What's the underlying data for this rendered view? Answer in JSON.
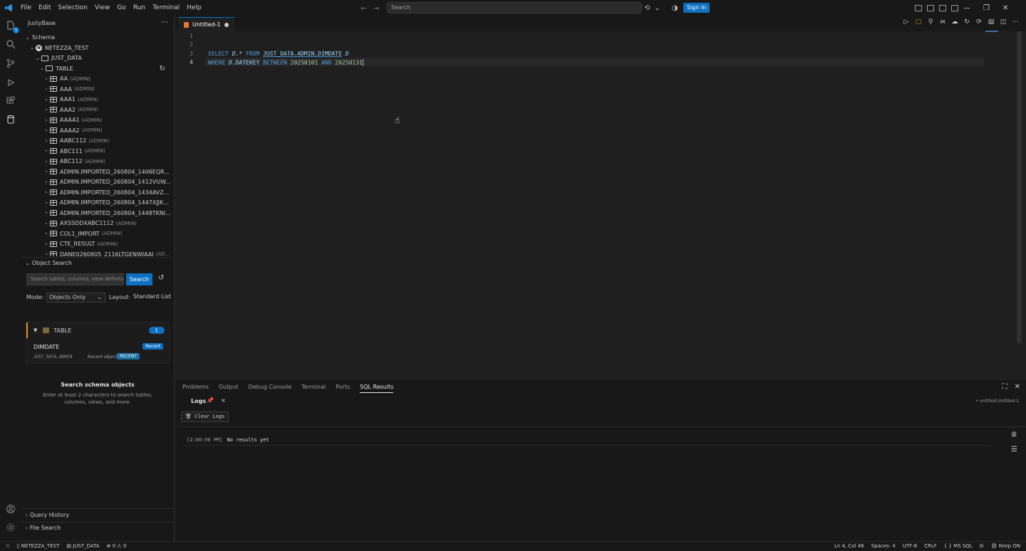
{
  "menu": [
    "File",
    "Edit",
    "Selection",
    "View",
    "Go",
    "Run",
    "Terminal",
    "Help"
  ],
  "command_center": {
    "placeholder": "Search"
  },
  "account": {
    "sign_in": "Sign In"
  },
  "activity": {
    "explorer_badge": "1"
  },
  "sidebar": {
    "title": "JustyBase",
    "schema_section": "Schema",
    "tree": [
      {
        "label": "NETEZZA_TEST",
        "owner": "",
        "kind": "server",
        "depth": 1
      },
      {
        "label": "JUST_DATA",
        "owner": "",
        "kind": "db",
        "depth": 2
      },
      {
        "label": "TABLE",
        "owner": "",
        "kind": "folder",
        "depth": 3
      },
      {
        "label": "AA",
        "owner": "(ADMIN)",
        "kind": "table",
        "depth": 4
      },
      {
        "label": "AAA",
        "owner": "(ADMIN)",
        "kind": "table",
        "depth": 4
      },
      {
        "label": "AAA1",
        "owner": "(ADMIN)",
        "kind": "table",
        "depth": 4
      },
      {
        "label": "AAA2",
        "owner": "(ADMIN)",
        "kind": "table",
        "depth": 4
      },
      {
        "label": "AAAA1",
        "owner": "(ADMIN)",
        "kind": "table",
        "depth": 4
      },
      {
        "label": "AAAA2",
        "owner": "(ADMIN)",
        "kind": "table",
        "depth": 4
      },
      {
        "label": "AABC112",
        "owner": "(ADMIN)",
        "kind": "table",
        "depth": 4
      },
      {
        "label": "ABC111",
        "owner": "(ADMIN)",
        "kind": "table",
        "depth": 4
      },
      {
        "label": "ABC112",
        "owner": "(ADMIN)",
        "kind": "table",
        "depth": 4
      },
      {
        "label": "ADMIN.IMPORTED_260804_1406EQR...",
        "owner": "",
        "kind": "table",
        "depth": 4
      },
      {
        "label": "ADMIN.IMPORTED_260804_1412VUW...",
        "owner": "",
        "kind": "table",
        "depth": 4
      },
      {
        "label": "ADMIN.IMPORTED_260804_1434AVZ...",
        "owner": "",
        "kind": "table",
        "depth": 4
      },
      {
        "label": "ADMIN.IMPORTED_260804_1447XJJK...",
        "owner": "",
        "kind": "table",
        "depth": 4
      },
      {
        "label": "ADMIN.IMPORTED_260804_1448TKNI...",
        "owner": "",
        "kind": "table",
        "depth": 4
      },
      {
        "label": "AXSSDDXABC1112",
        "owner": "(ADMIN)",
        "kind": "table",
        "depth": 4
      },
      {
        "label": "COL1_IMPORT",
        "owner": "(ADMIN)",
        "kind": "table",
        "depth": 4
      },
      {
        "label": "CTE_RESULT",
        "owner": "(ADMIN)",
        "kind": "table",
        "depth": 4
      },
      {
        "label": "DANE0260805_2116LTGENWJAAI",
        "owner": "(AD...",
        "kind": "table",
        "depth": 4
      }
    ],
    "object_search": {
      "title": "Object Search",
      "placeholder": "Search tables, columns, view definitions...",
      "button": "Search",
      "mode_label": "Mode:",
      "mode_value": "Objects Only",
      "layout_label": "Layout:",
      "layout_value": "Standard List",
      "group": {
        "name": "TABLE",
        "count": "1"
      },
      "result": {
        "name": "DIMDATE",
        "path": "JUST_DATA.ADMIN",
        "tag": "Recent object",
        "badge_recent": "Recent",
        "badge_upper": "RECENT"
      },
      "empty_title": "Search schema objects",
      "empty_desc": "Enter at least 2 characters to search tables, columns, views, and more."
    },
    "query_history": "Query History",
    "file_search": "File Search"
  },
  "editor": {
    "tab": "Untitled-1",
    "line_numbers": [
      "1",
      "2",
      "3",
      "4"
    ],
    "line3": {
      "k1": "SELECT",
      "a1": "D",
      "t1": ".* ",
      "k2": "FROM",
      "tbl": "JUST_DATA.ADMIN.DIMDATE",
      "a2": "D"
    },
    "line4": {
      "k1": "WHERE",
      "a1": "D",
      "col": ".DATEKEY ",
      "k2": "BETWEEN",
      "n1": "20250101",
      "k3": "AND",
      "n2": "20250131"
    }
  },
  "panel": {
    "tabs": [
      "Problems",
      "Output",
      "Debug Console",
      "Terminal",
      "Ports",
      "SQL Results"
    ],
    "active_tab": "SQL Results",
    "subtab": "Logs",
    "subtab_right": "• untitled:Untitled-1",
    "clear_logs": "Clear Logs",
    "log_time": "[2:00:06 PM]",
    "log_msg": "No results yet"
  },
  "status": {
    "connection": "NETEZZA_TEST",
    "database": "JUST_DATA",
    "problems": "0",
    "warnings": "0",
    "position": "Ln 4, Col 46",
    "spaces": "Spaces: 4",
    "encoding": "UTF-8",
    "eol": "CRLF",
    "language": "MS SQL",
    "keep": "Keep ON"
  }
}
